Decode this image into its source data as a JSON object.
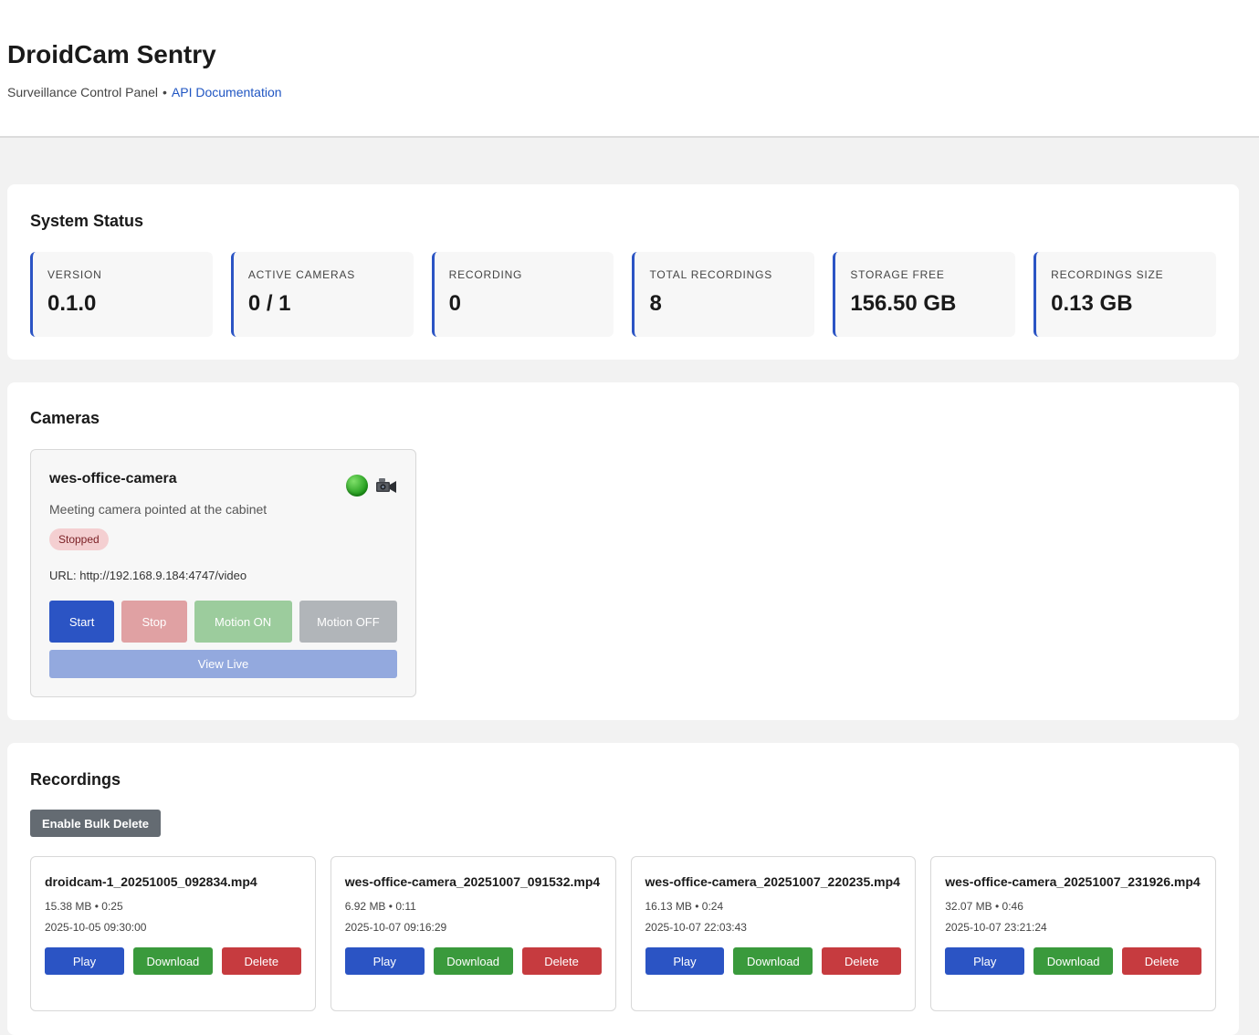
{
  "header": {
    "title": "DroidCam Sentry",
    "subtitle": "Surveillance Control Panel",
    "separator": "•",
    "api_link": "API Documentation"
  },
  "status": {
    "heading": "System Status",
    "stats": [
      {
        "label": "VERSION",
        "value": "0.1.0"
      },
      {
        "label": "ACTIVE CAMERAS",
        "value": "0 / 1"
      },
      {
        "label": "RECORDING",
        "value": "0"
      },
      {
        "label": "TOTAL RECORDINGS",
        "value": "8"
      },
      {
        "label": "STORAGE FREE",
        "value": "156.50 GB"
      },
      {
        "label": "RECORDINGS SIZE",
        "value": "0.13 GB"
      }
    ],
    "accent_color": "#2b54c4"
  },
  "cameras": {
    "heading": "Cameras",
    "items": [
      {
        "name": "wes-office-camera",
        "description": "Meeting camera pointed at the cabinet",
        "state": "Stopped",
        "url": "URL: http://192.168.9.184:4747/video",
        "status_icon": "green-circle-icon",
        "type_icon": "video-camera-icon",
        "buttons": {
          "start": "Start",
          "stop": "Stop",
          "motion_on": "Motion ON",
          "motion_off": "Motion OFF",
          "view_live": "View Live"
        }
      }
    ]
  },
  "recordings": {
    "heading": "Recordings",
    "bulk_delete": "Enable Bulk Delete",
    "items": [
      {
        "filename": "droidcam-1_20251005_092834.mp4",
        "size": "15.38 MB",
        "duration": "0:25",
        "date": "2025-10-05 09:30:00"
      },
      {
        "filename": "wes-office-camera_20251007_091532.mp4",
        "size": "6.92 MB",
        "duration": "0:11",
        "date": "2025-10-07 09:16:29"
      },
      {
        "filename": "wes-office-camera_20251007_220235.mp4",
        "size": "16.13 MB",
        "duration": "0:24",
        "date": "2025-10-07 22:03:43"
      },
      {
        "filename": "wes-office-camera_20251007_231926.mp4",
        "size": "32.07 MB",
        "duration": "0:46",
        "date": "2025-10-07 23:21:24"
      }
    ],
    "actions": {
      "play": "Play",
      "download": "Download",
      "delete": "Delete"
    },
    "meta_separator": "•"
  },
  "colors": {
    "primary": "#2b54c4",
    "success": "#3a9a3c",
    "danger": "#c63b3f",
    "neutral": "#646b72",
    "link": "#1f55c2"
  }
}
